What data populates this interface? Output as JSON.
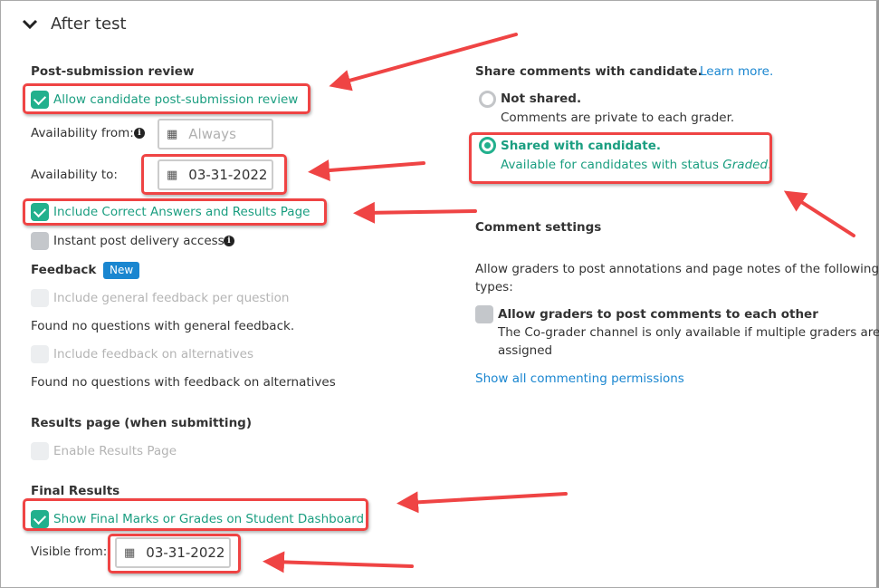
{
  "section": {
    "title": "After test"
  },
  "left": {
    "post_review": {
      "heading": "Post-submission review",
      "allow_label": "Allow candidate post-submission review",
      "allow_checked": true,
      "from_label": "Availability from:",
      "from_placeholder": "Always",
      "to_label": "Availability to:",
      "to_value": "03-31-2022",
      "include_label": "Include Correct Answers and Results Page",
      "include_checked": true,
      "instant_label": "Instant post delivery access",
      "instant_checked": false
    },
    "feedback": {
      "heading": "Feedback",
      "badge": "New",
      "general_label": "Include general feedback per question",
      "general_note": "Found no questions with general feedback.",
      "alt_label": "Include feedback on alternatives",
      "alt_note": "Found no questions with feedback on alternatives"
    },
    "results": {
      "heading": "Results page (when submitting)",
      "enable_label": "Enable Results Page"
    },
    "final": {
      "heading": "Final Results",
      "show_label": "Show Final Marks or Grades on Student Dashboard",
      "show_checked": true,
      "visible_label": "Visible from:",
      "visible_value": "03-31-2022"
    }
  },
  "right": {
    "share": {
      "heading": "Share comments with candidate.",
      "learn_more": "Learn more.",
      "options": [
        {
          "title": "Not shared.",
          "desc": "Comments are private to each grader.",
          "selected": false
        },
        {
          "title": "Shared with candidate.",
          "desc": "Available for candidates with status ",
          "desc_em": "Graded",
          "desc_end": ".",
          "selected": true
        }
      ]
    },
    "comment": {
      "heading": "Comment settings",
      "desc1": "Allow graders to post annotations and page notes of the following",
      "desc2": "types:",
      "allow_label": "Allow graders to post comments to each other",
      "allow_checked": false,
      "note1": "The Co-grader channel is only available if multiple graders are",
      "note2": "assigned",
      "show_all": "Show all commenting permissions"
    }
  },
  "colors": {
    "accent": "#22b08d",
    "link": "#1a86d0",
    "annotation": "#ef4444"
  }
}
